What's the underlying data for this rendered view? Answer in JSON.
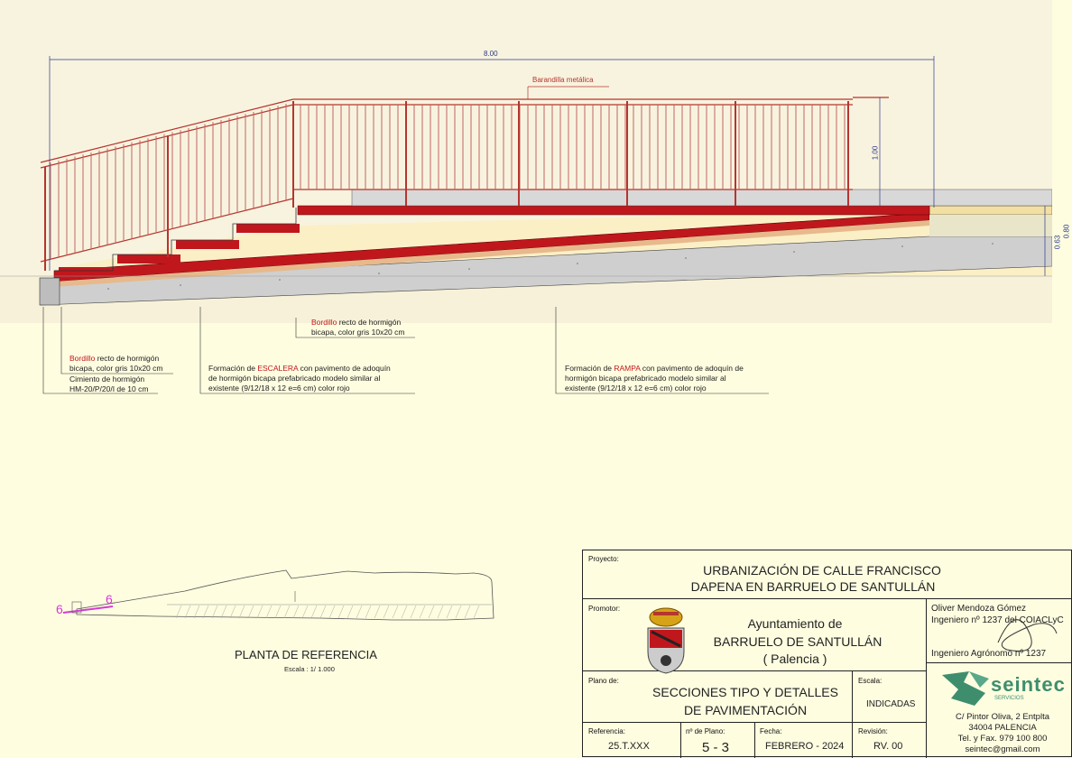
{
  "drawing": {
    "dim_total": "8.00",
    "dim_rail_height": "1.00",
    "dim_063": "0.63",
    "dim_080": "0.80",
    "label_railing": "Barandilla metálica"
  },
  "notes": {
    "curb_center_1": "Bordillo",
    "curb_center_2": " recto de hormigón",
    "curb_center_3": "bicapa, color gris 10x20 cm",
    "curb_left_1": "Bordillo",
    "curb_left_2": " recto de hormigón",
    "curb_left_3": "bicapa, color gris 10x20 cm",
    "foundation_1": "Cimiento de hormigón",
    "foundation_2": "HM-20/P/20/I de 10 cm",
    "stair_1": "Formación de ",
    "stair_2": "ESCALERA",
    "stair_3": " con pavimento de adoquín",
    "stair_4": "de hormigón bicapa prefabricado modelo similar al",
    "stair_5": "existente (9/12/18 x 12 e=6 cm) color rojo",
    "ramp_1": "Formación de ",
    "ramp_2": "RAMPA",
    "ramp_3": " con pavimento de adoquín de",
    "ramp_4": "hormigón bicapa prefabricado modelo similar al",
    "ramp_5": "existente (9/12/18 x 12 e=6 cm) color rojo"
  },
  "plan": {
    "title": "PLANTA  DE  REFERENCIA",
    "scale": "Escala : 1/ 1.000",
    "marker": "6"
  },
  "title_block": {
    "proyecto_label": "Proyecto:",
    "proyecto_1": "URBANIZACIÓN DE  CALLE FRANCISCO",
    "proyecto_2": "DAPENA   EN  BARRUELO  DE  SANTULLÁN",
    "promotor_label": "Promotor:",
    "promotor_1": "Ayuntamiento  de",
    "promotor_2": "BARRUELO  DE  SANTULLÁN",
    "promotor_3": "( Palencia )",
    "engineer_1": "Oliver Mendoza Gómez",
    "engineer_2": "Ingeniero nº 1237 del COIACLyC",
    "engineer_3": "Ingeniero Agrónomo nº 1237",
    "plano_label": "Plano de:",
    "plano_1": "SECCIONES TIPO Y DETALLES",
    "plano_2": "DE PAVIMENTACIÓN",
    "escala_label": "Escala:",
    "escala_value": "INDICADAS",
    "ref_label": "Referencia:",
    "ref_value": "25.T.XXX",
    "nplano_label": "nº de Plano:",
    "nplano_value": "5 - 3",
    "fecha_label": "Fecha:",
    "fecha_value": "FEBRERO - 2024",
    "rev_label": "Revisión:",
    "rev_value": "RV. 00",
    "company_logo": "seintec",
    "company_sub": "SERVICIOS",
    "company_addr_1": "C/ Pintor Oliva, 2  Entplta",
    "company_addr_2": "34004   PALENCIA",
    "company_addr_3": "Tel. y Fax. 979 100 800",
    "company_addr_4": "seintec@gmail.com"
  }
}
